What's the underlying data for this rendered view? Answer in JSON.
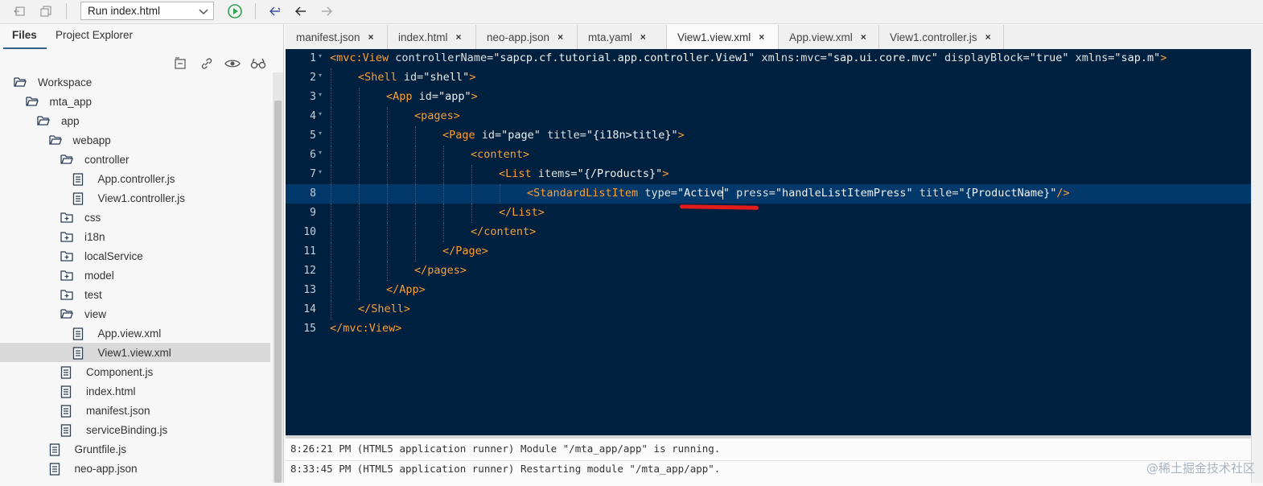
{
  "toolbar": {
    "run_config": "Run index.html"
  },
  "left_panel": {
    "tabs": [
      "Files",
      "Project Explorer"
    ],
    "tree": [
      {
        "label": "Workspace",
        "type": "folder-open",
        "depth": 0
      },
      {
        "label": "mta_app",
        "type": "folder-open",
        "depth": 1
      },
      {
        "label": "app",
        "type": "folder-open",
        "depth": 2
      },
      {
        "label": "webapp",
        "type": "folder-open",
        "depth": 3
      },
      {
        "label": "controller",
        "type": "folder-open",
        "depth": 4
      },
      {
        "label": "App.controller.js",
        "type": "file",
        "depth": 5
      },
      {
        "label": "View1.controller.js",
        "type": "file",
        "depth": 5
      },
      {
        "label": "css",
        "type": "folder-closed",
        "depth": 4
      },
      {
        "label": "i18n",
        "type": "folder-closed",
        "depth": 4
      },
      {
        "label": "localService",
        "type": "folder-closed",
        "depth": 4
      },
      {
        "label": "model",
        "type": "folder-closed",
        "depth": 4
      },
      {
        "label": "test",
        "type": "folder-closed",
        "depth": 4
      },
      {
        "label": "view",
        "type": "folder-open",
        "depth": 4
      },
      {
        "label": "App.view.xml",
        "type": "file",
        "depth": 5
      },
      {
        "label": "View1.view.xml",
        "type": "file",
        "depth": 5,
        "selected": true
      },
      {
        "label": "Component.js",
        "type": "file",
        "depth": 4
      },
      {
        "label": "index.html",
        "type": "file",
        "depth": 4
      },
      {
        "label": "manifest.json",
        "type": "file",
        "depth": 4
      },
      {
        "label": "serviceBinding.js",
        "type": "file",
        "depth": 4
      },
      {
        "label": "Gruntfile.js",
        "type": "file",
        "depth": 3
      },
      {
        "label": "neo-app.json",
        "type": "file",
        "depth": 3
      }
    ]
  },
  "editor_tabs": [
    {
      "label": "manifest.json",
      "active": false
    },
    {
      "label": "index.html",
      "active": false
    },
    {
      "label": "neo-app.json",
      "active": false
    },
    {
      "label": "mta.yaml",
      "active": false
    },
    {
      "label": "View1.view.xml",
      "active": true
    },
    {
      "label": "App.view.xml",
      "active": false
    },
    {
      "label": "View1.controller.js",
      "active": false
    }
  ],
  "editor": {
    "current_line": 8,
    "lines": [
      {
        "n": "1",
        "indent": 0,
        "fold": true,
        "tokens": [
          [
            "tag",
            "<mvc:View "
          ],
          [
            "attr",
            "controllerName="
          ],
          [
            "str",
            "\"sapcp.cf.tutorial.app.controller.View1\" "
          ],
          [
            "attr",
            "xmlns:mvc="
          ],
          [
            "str",
            "\"sap.ui.core.mvc\" "
          ],
          [
            "attr",
            "displayBlock="
          ],
          [
            "str",
            "\"true\" "
          ],
          [
            "attr",
            "xmlns="
          ],
          [
            "str",
            "\"sap.m\""
          ],
          [
            "tag",
            ">"
          ]
        ]
      },
      {
        "n": "2",
        "indent": 1,
        "fold": true,
        "tokens": [
          [
            "tag",
            "<Shell "
          ],
          [
            "attr",
            "id="
          ],
          [
            "str",
            "\"shell\""
          ],
          [
            "tag",
            ">"
          ]
        ]
      },
      {
        "n": "3",
        "indent": 2,
        "fold": true,
        "tokens": [
          [
            "tag",
            "<App "
          ],
          [
            "attr",
            "id="
          ],
          [
            "str",
            "\"app\""
          ],
          [
            "tag",
            ">"
          ]
        ]
      },
      {
        "n": "4",
        "indent": 3,
        "fold": true,
        "tokens": [
          [
            "tag",
            "<pages>"
          ]
        ]
      },
      {
        "n": "5",
        "indent": 4,
        "fold": true,
        "tokens": [
          [
            "tag",
            "<Page "
          ],
          [
            "attr",
            "id="
          ],
          [
            "str",
            "\"page\" "
          ],
          [
            "attr",
            "title="
          ],
          [
            "str",
            "\"{i18n>title}\""
          ],
          [
            "tag",
            ">"
          ]
        ]
      },
      {
        "n": "6",
        "indent": 5,
        "fold": true,
        "tokens": [
          [
            "tag",
            "<content>"
          ]
        ]
      },
      {
        "n": "7",
        "indent": 6,
        "fold": true,
        "tokens": [
          [
            "tag",
            "<List "
          ],
          [
            "attr",
            "items="
          ],
          [
            "str",
            "\"{/Products}\""
          ],
          [
            "tag",
            ">"
          ]
        ]
      },
      {
        "n": "8",
        "indent": 7,
        "fold": false,
        "tokens": [
          [
            "tag",
            "<StandardListItem "
          ],
          [
            "attr",
            "type="
          ],
          [
            "str",
            "\"Active"
          ],
          [
            "cursor",
            ""
          ],
          [
            "str",
            "\" "
          ],
          [
            "attr",
            "press="
          ],
          [
            "str",
            "\"handleListItemPress\" "
          ],
          [
            "attr",
            "title="
          ],
          [
            "str",
            "\"{ProductName}\""
          ],
          [
            "tag",
            "/>"
          ]
        ]
      },
      {
        "n": "9",
        "indent": 6,
        "fold": false,
        "tokens": [
          [
            "tag",
            "</List>"
          ]
        ]
      },
      {
        "n": "10",
        "indent": 5,
        "fold": false,
        "tokens": [
          [
            "tag",
            "</content>"
          ]
        ]
      },
      {
        "n": "11",
        "indent": 4,
        "fold": false,
        "tokens": [
          [
            "tag",
            "</Page>"
          ]
        ]
      },
      {
        "n": "12",
        "indent": 3,
        "fold": false,
        "tokens": [
          [
            "tag",
            "</pages>"
          ]
        ]
      },
      {
        "n": "13",
        "indent": 2,
        "fold": false,
        "tokens": [
          [
            "tag",
            "</App>"
          ]
        ]
      },
      {
        "n": "14",
        "indent": 1,
        "fold": false,
        "tokens": [
          [
            "tag",
            "</Shell>"
          ]
        ]
      },
      {
        "n": "15",
        "indent": 0,
        "fold": false,
        "tokens": [
          [
            "tag",
            "</mvc:View>"
          ]
        ]
      }
    ]
  },
  "console": {
    "lines": [
      "8:26:21 PM (HTML5 application runner) Module \"/mta_app/app\" is running.",
      "8:33:45 PM (HTML5 application runner) Restarting module \"/mta_app/app\"."
    ]
  },
  "watermark": "@稀土掘金技术社区",
  "colors": {
    "editor_bg": "#002040",
    "current_line": "#03396a",
    "tag": "#ff9f2e",
    "annotation_underline": "#e21b1b"
  }
}
